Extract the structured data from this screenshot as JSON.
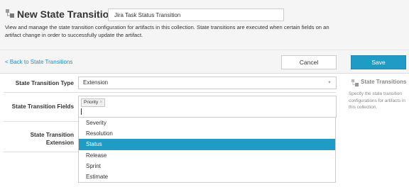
{
  "header": {
    "title": "New State Transition",
    "name_value": "Jira Task Status Transition",
    "description": "View and manage the state transition configuration for artifacts in this collection. State transitions are executed when certain fields on an artifact change in order to successfully update the artifact."
  },
  "toolbar": {
    "back_label": "< Back to State Transitions",
    "cancel_label": "Cancel",
    "save_label": "Save"
  },
  "form": {
    "type_label": "State Transition Type",
    "type_value": "Extension",
    "fields_label": "State Transition Fields",
    "fields_tags": [
      "Priority"
    ],
    "extension_label_line1": "State Transition",
    "extension_label_line2": "Extension"
  },
  "dropdown": {
    "options": [
      "Severity",
      "Resolution",
      "Status",
      "Release",
      "Sprint",
      "Estimate"
    ],
    "highlighted": "Status"
  },
  "sidebar": {
    "title": "State Transitions",
    "description": "Specify the state transition configurations for artifacts in this collection."
  },
  "colors": {
    "accent": "#1f9cc5",
    "link": "#1f8fbf",
    "header_bg": "#f5f5f5"
  }
}
